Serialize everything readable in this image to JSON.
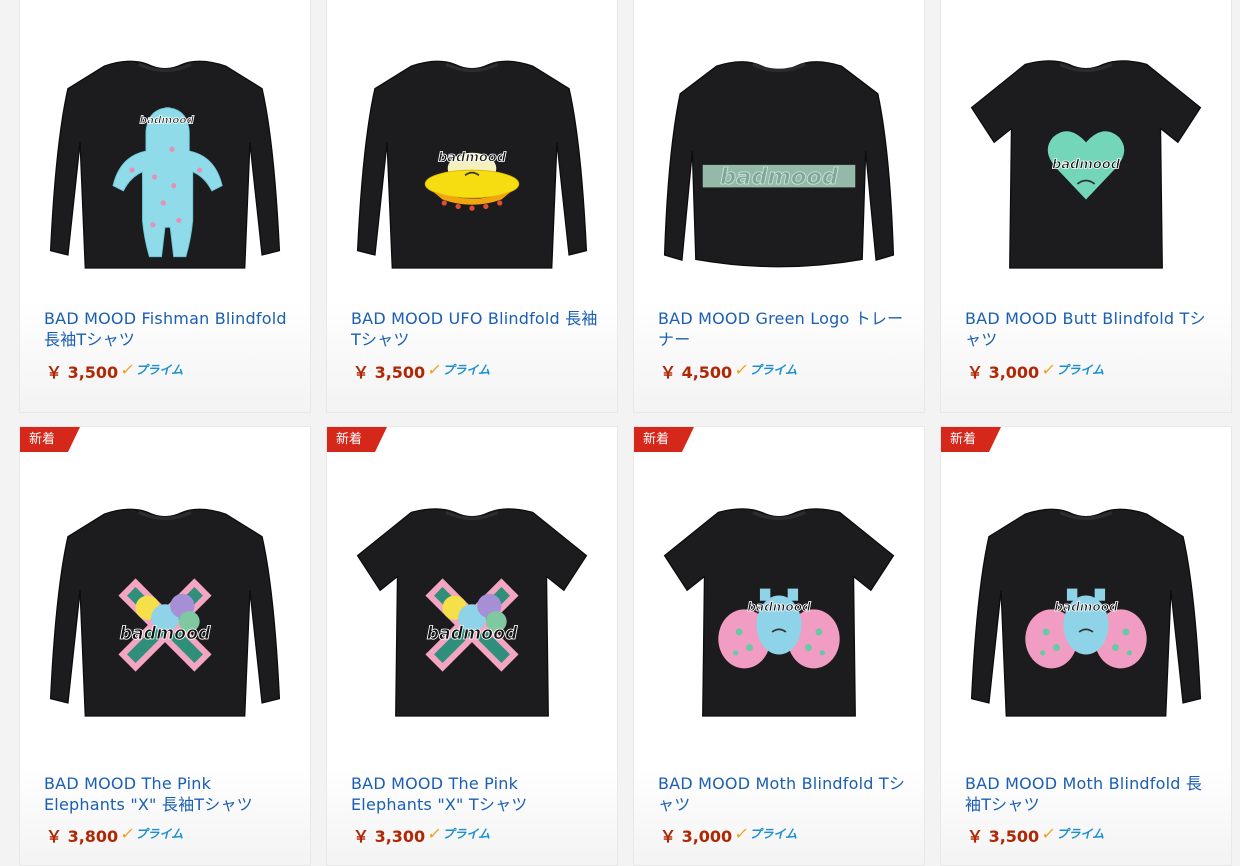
{
  "products": [
    {
      "title": "BAD MOOD Fishman Blindfold 長袖Tシャツ",
      "price": "￥ 3,500",
      "prime": "プライム",
      "badge": "",
      "shirt": "long",
      "graphic": "fishman"
    },
    {
      "title": "BAD MOOD UFO Blindfold 長袖Tシャツ",
      "price": "￥ 3,500",
      "prime": "プライム",
      "badge": "",
      "shirt": "long",
      "graphic": "ufo"
    },
    {
      "title": "BAD MOOD Green Logo トレーナー",
      "price": "￥ 4,500",
      "prime": "プライム",
      "badge": "",
      "shirt": "sweat",
      "graphic": "greenlogo"
    },
    {
      "title": "BAD MOOD Butt Blindfold Tシャツ",
      "price": "￥ 3,000",
      "prime": "プライム",
      "badge": "",
      "shirt": "short",
      "graphic": "butt"
    },
    {
      "title": "BAD MOOD The Pink Elephants \"X\" 長袖Tシャツ",
      "price": "￥ 3,800",
      "prime": "プライム",
      "badge": "新着",
      "shirt": "long",
      "graphic": "elephants"
    },
    {
      "title": "BAD MOOD The Pink Elephants \"X\" Tシャツ",
      "price": "￥ 3,300",
      "prime": "プライム",
      "badge": "新着",
      "shirt": "short",
      "graphic": "elephants"
    },
    {
      "title": "BAD MOOD Moth Blindfold Tシャツ",
      "price": "￥ 3,000",
      "prime": "プライム",
      "badge": "新着",
      "shirt": "short",
      "graphic": "moth"
    },
    {
      "title": "BAD MOOD Moth Blindfold 長袖Tシャツ",
      "price": "￥ 3,500",
      "prime": "プライム",
      "badge": "新着",
      "shirt": "long",
      "graphic": "moth"
    }
  ],
  "logo_text": "badmood",
  "colors": {
    "link": "#1a5fb4",
    "price": "#b12704",
    "badge": "#d5281b",
    "prime_check": "#f39c12",
    "prime_text": "#1a8fd1",
    "shirt": "#1c1c1e"
  }
}
